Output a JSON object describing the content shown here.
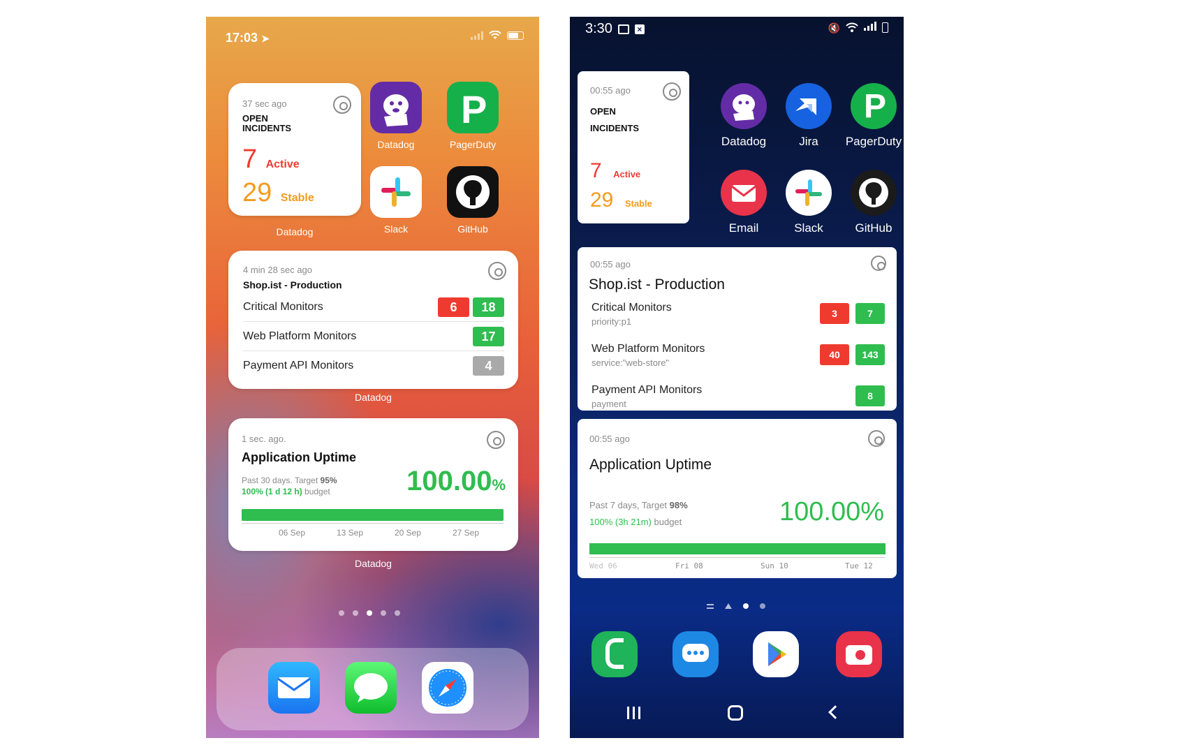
{
  "ios": {
    "time": "17:03",
    "incidents_widget": {
      "updated": "37 sec ago",
      "title_line1": "OPEN",
      "title_line2": "INCIDENTS",
      "active_count": "7",
      "active_label": "Active",
      "stable_count": "29",
      "stable_label": "Stable",
      "caption": "Datadog"
    },
    "apps": [
      {
        "label": "Datadog",
        "icon": "datadog-icon"
      },
      {
        "label": "PagerDuty",
        "icon": "pagerduty-icon"
      },
      {
        "label": "Slack",
        "icon": "slack-icon"
      },
      {
        "label": "GitHub",
        "icon": "github-icon"
      }
    ],
    "monitors_widget": {
      "updated": "4 min 28 sec ago",
      "title": "Shop.ist - Production",
      "rows": [
        {
          "name": "Critical Monitors",
          "counts": [
            {
              "value": "6",
              "color": "#ef3b2f"
            },
            {
              "value": "18",
              "color": "#2fbd4f"
            }
          ]
        },
        {
          "name": "Web Platform Monitors",
          "counts": [
            {
              "value": "17",
              "color": "#2fbd4f"
            }
          ]
        },
        {
          "name": "Payment API Monitors",
          "counts": [
            {
              "value": "4",
              "color": "#a9a9a9"
            }
          ]
        }
      ],
      "caption": "Datadog"
    },
    "uptime_widget": {
      "updated": "1 sec. ago.",
      "title": "Application Uptime",
      "period": "Past 30 days. Target ",
      "target": "95%",
      "budget_value": "100% (1 d 12 h)",
      "budget_label": " budget",
      "value_main": "100.00",
      "value_unit": "%",
      "bar_fill": 1.0,
      "ticks": [
        "06 Sep",
        "13 Sep",
        "20 Sep",
        "27 Sep"
      ],
      "caption": "Datadog"
    },
    "page_dots": {
      "count": 5,
      "active": 2
    },
    "dock": [
      {
        "icon": "mail-icon"
      },
      {
        "icon": "messages-icon"
      },
      {
        "icon": "safari-icon"
      }
    ]
  },
  "android": {
    "time": "3:30",
    "incidents_widget": {
      "updated": "00:55 ago",
      "title_line1": "OPEN",
      "title_line2": "INCIDENTS",
      "active_count": "7",
      "active_label": "Active",
      "stable_count": "29",
      "stable_label": "Stable"
    },
    "apps": [
      {
        "label": "Datadog",
        "icon": "datadog-icon"
      },
      {
        "label": "Jira",
        "icon": "jira-icon"
      },
      {
        "label": "PagerDuty",
        "icon": "pagerduty-icon"
      },
      {
        "label": "Email",
        "icon": "email-icon"
      },
      {
        "label": "Slack",
        "icon": "slack-icon"
      },
      {
        "label": "GitHub",
        "icon": "github-icon"
      }
    ],
    "monitors_widget": {
      "updated": "00:55 ago",
      "title": "Shop.ist - Production",
      "rows": [
        {
          "name": "Critical Monitors",
          "query": "priority:p1",
          "counts": [
            {
              "value": "3",
              "color": "#ef3b2f"
            },
            {
              "value": "7",
              "color": "#2fbd4f"
            }
          ]
        },
        {
          "name": "Web Platform Monitors",
          "query": "service:\"web-store\"",
          "counts": [
            {
              "value": "40",
              "color": "#ef3b2f"
            },
            {
              "value": "143",
              "color": "#2fbd4f"
            }
          ]
        },
        {
          "name": "Payment API Monitors",
          "query": "payment",
          "counts": [
            {
              "value": "8",
              "color": "#2fbd4f"
            }
          ]
        }
      ]
    },
    "uptime_widget": {
      "updated": "00:55 ago",
      "title": "Application Uptime",
      "period": "Past 7 days, Target ",
      "target": "98%",
      "budget_value": "100% (3h 21m)",
      "budget_label": " budget",
      "value": "100.00%",
      "bar_fill": 1.0,
      "ticks": [
        "Wed 06",
        "Fri 08",
        "Sun 10",
        "Tue 12"
      ]
    },
    "dock": [
      {
        "icon": "phone-icon",
        "color": "#1fb35a"
      },
      {
        "icon": "messages-icon",
        "color": "#1e88e5"
      },
      {
        "icon": "play-store-icon",
        "color": "#ffffff"
      },
      {
        "icon": "camera-icon",
        "color": "#e8334a"
      }
    ]
  }
}
